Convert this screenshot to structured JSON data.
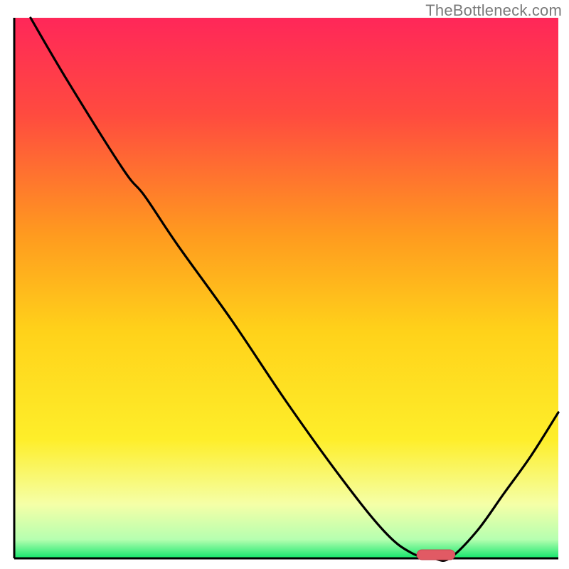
{
  "watermark": "TheBottleneck.com",
  "chart_data": {
    "type": "line",
    "title": "",
    "xlabel": "",
    "ylabel": "",
    "xlim": [
      0,
      100
    ],
    "ylim": [
      0,
      100
    ],
    "description": "Bottleneck curve over a red-yellow-green gradient. Values are bottleneck percentage (0 = green/no bottleneck, 100 = red/severe). Curve descends steeply from top-left, levels out near zero around x≈75–80 (optimum marker), then rises again toward the right edge.",
    "x": [
      3,
      10,
      20,
      24,
      30,
      40,
      50,
      60,
      68,
      73,
      77,
      80,
      85,
      90,
      95,
      100
    ],
    "values": [
      100,
      88,
      72,
      67,
      58,
      44,
      29,
      15,
      5,
      1,
      0,
      0,
      5,
      12,
      19,
      27
    ],
    "optimum_marker": {
      "x_start": 74,
      "x_end": 81,
      "y": 0
    },
    "gradient_stops": [
      {
        "offset": 0.0,
        "color": "#ff2759"
      },
      {
        "offset": 0.18,
        "color": "#ff4b3f"
      },
      {
        "offset": 0.4,
        "color": "#ff9a1f"
      },
      {
        "offset": 0.58,
        "color": "#ffd21a"
      },
      {
        "offset": 0.78,
        "color": "#feee2a"
      },
      {
        "offset": 0.9,
        "color": "#f5ffa7"
      },
      {
        "offset": 0.965,
        "color": "#b6ffb0"
      },
      {
        "offset": 1.0,
        "color": "#13e66c"
      }
    ]
  },
  "plot": {
    "margin_left": 20,
    "margin_right": 15,
    "margin_top": 25,
    "margin_bottom": 15
  },
  "colors": {
    "axis": "#000000",
    "curve": "#000000",
    "marker_fill": "#e15a64",
    "marker_stroke": "#c94a54"
  }
}
